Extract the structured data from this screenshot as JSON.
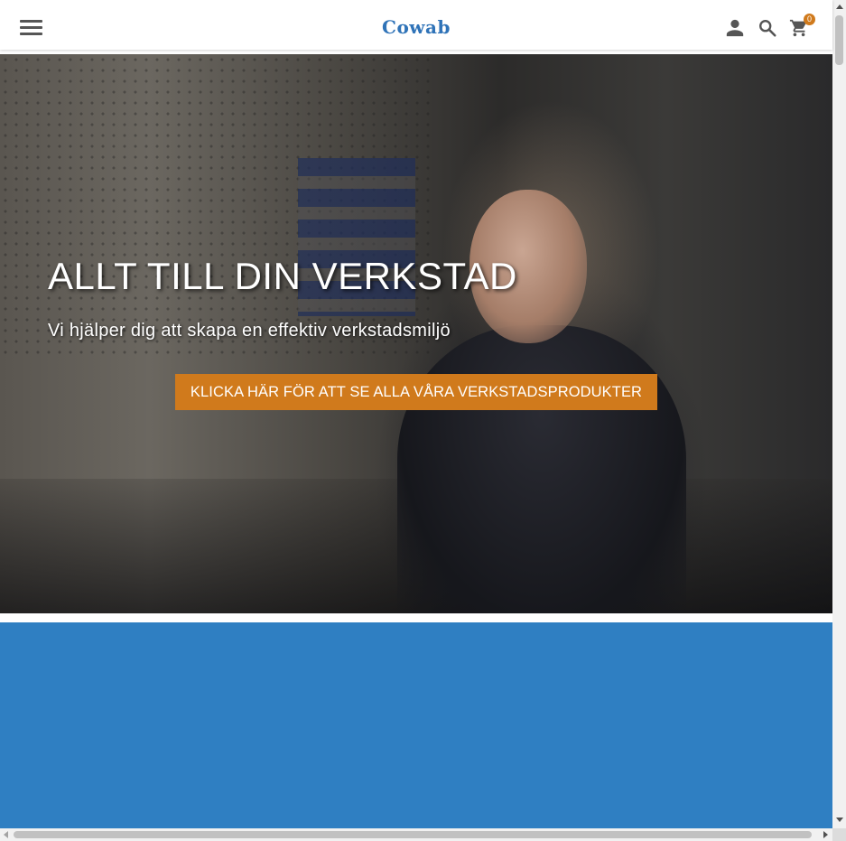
{
  "header": {
    "logo_text": "Cowab",
    "menu_icon": "hamburger-menu-icon",
    "account_icon": "person-icon",
    "search_icon": "search-icon",
    "cart_icon": "shopping-cart-icon",
    "cart_count": "0"
  },
  "hero": {
    "title": "ALLT TILL DIN VERKSTAD",
    "subtitle": "Vi hjälper dig att skapa en effektiv verkstadsmiljö",
    "cta_label": "KLICKA HÄR FÖR ATT SE ALLA VÅRA VERKSTADSPRODUKTER"
  },
  "colors": {
    "brand_blue": "#2f73b8",
    "section_blue": "#2f7fc2",
    "cta_orange": "#d07a1c",
    "badge_orange": "#d07a1c"
  }
}
